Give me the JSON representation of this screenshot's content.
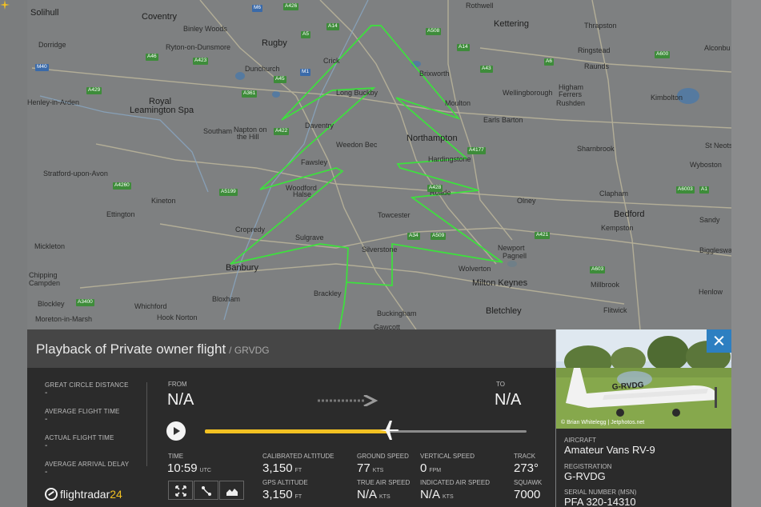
{
  "map": {
    "towns": [
      {
        "name": "Solihull",
        "big": true
      },
      {
        "name": "Coventry",
        "big": true
      },
      {
        "name": "Binley Woods",
        "big": false
      },
      {
        "name": "Ryton-on-Dunsmore",
        "big": false
      },
      {
        "name": "Rugby",
        "big": true
      },
      {
        "name": "Dunchurch",
        "big": false
      },
      {
        "name": "Dorridge",
        "big": false
      },
      {
        "name": "Royal",
        "big": true
      },
      {
        "name": "Leamington Spa",
        "big": true
      },
      {
        "name": "Southam",
        "big": false
      },
      {
        "name": "Napton on",
        "big": false
      },
      {
        "name": "the Hill",
        "big": false
      },
      {
        "name": "Stratford-upon-Avon",
        "big": false
      },
      {
        "name": "Kineton",
        "big": false
      },
      {
        "name": "Ettington",
        "big": false
      },
      {
        "name": "Mickleton",
        "big": false
      },
      {
        "name": "Chipping",
        "big": false
      },
      {
        "name": "Campden",
        "big": false
      },
      {
        "name": "Blockley",
        "big": false
      },
      {
        "name": "Moreton-in-Marsh",
        "big": false
      },
      {
        "name": "Whichford",
        "big": false
      },
      {
        "name": "Hook Norton",
        "big": false
      },
      {
        "name": "Bloxham",
        "big": false
      },
      {
        "name": "Banbury",
        "big": true
      },
      {
        "name": "Cropredy",
        "big": false
      },
      {
        "name": "Sulgrave",
        "big": false
      },
      {
        "name": "Brackley",
        "big": false
      },
      {
        "name": "Crick",
        "big": false
      },
      {
        "name": "Long Buckby",
        "big": false
      },
      {
        "name": "Daventry",
        "big": false
      },
      {
        "name": "Weedon Bec",
        "big": false
      },
      {
        "name": "Fawsley",
        "big": false
      },
      {
        "name": "Woodford",
        "big": false
      },
      {
        "name": "Halse",
        "big": false
      },
      {
        "name": "Towcester",
        "big": false
      },
      {
        "name": "Silverstone",
        "big": false
      },
      {
        "name": "Buckingham",
        "big": false
      },
      {
        "name": "Gawcott",
        "big": false
      },
      {
        "name": "Northampton",
        "big": true
      },
      {
        "name": "Hardingstone",
        "big": false
      },
      {
        "name": "Roade",
        "big": false
      },
      {
        "name": "Brixworth",
        "big": false
      },
      {
        "name": "Moulton",
        "big": false
      },
      {
        "name": "Kettering",
        "big": true
      },
      {
        "name": "Rothwell",
        "big": false
      },
      {
        "name": "Wellingborough",
        "big": false
      },
      {
        "name": "Earls Barton",
        "big": false
      },
      {
        "name": "Higham",
        "big": false
      },
      {
        "name": "Ferrers",
        "big": false
      },
      {
        "name": "Rushden",
        "big": false
      },
      {
        "name": "Thrapston",
        "big": false
      },
      {
        "name": "Ringstead",
        "big": false
      },
      {
        "name": "Raunds",
        "big": false
      },
      {
        "name": "Kimbolton",
        "big": false
      },
      {
        "name": "Alconbu",
        "big": false
      },
      {
        "name": "Sharnbrook",
        "big": false
      },
      {
        "name": "St Neots",
        "big": false
      },
      {
        "name": "Wyboston",
        "big": false
      },
      {
        "name": "Clapham",
        "big": false
      },
      {
        "name": "Bedford",
        "big": true
      },
      {
        "name": "Kempston",
        "big": false
      },
      {
        "name": "Sandy",
        "big": false
      },
      {
        "name": "Biggleswa",
        "big": false
      },
      {
        "name": "Olney",
        "big": false
      },
      {
        "name": "Newport",
        "big": false
      },
      {
        "name": "Pagnell",
        "big": false
      },
      {
        "name": "Wolverton",
        "big": false
      },
      {
        "name": "Milton Keynes",
        "big": true
      },
      {
        "name": "Bletchley",
        "big": true
      },
      {
        "name": "Millbrook",
        "big": false
      },
      {
        "name": "Flitwick",
        "big": false
      },
      {
        "name": "Henlow",
        "big": false
      },
      {
        "name": "Henley-in-Arden",
        "big": false
      }
    ],
    "roads": [
      "M6",
      "A426",
      "A5",
      "A14",
      "A508",
      "A43",
      "A6",
      "A45",
      "M1",
      "A423",
      "A361",
      "A46",
      "A422",
      "A429",
      "A4177",
      "A428",
      "A5199",
      "A34",
      "A509",
      "A421",
      "A603",
      "A600",
      "A1",
      "M40",
      "A3400",
      "A4260",
      "A6003",
      "A14"
    ],
    "track_color": "#3ce23c"
  },
  "panel": {
    "title": "Playback of Private owner flight",
    "callsign": "/ GRVDG",
    "stats": [
      {
        "label": "GREAT CIRCLE DISTANCE",
        "value": "-"
      },
      {
        "label": "AVERAGE FLIGHT TIME",
        "value": "-"
      },
      {
        "label": "ACTUAL FLIGHT TIME",
        "value": "-"
      },
      {
        "label": "AVERAGE ARRIVAL DELAY",
        "value": "-"
      }
    ],
    "from_label": "FROM",
    "from_value": "N/A",
    "to_label": "TO",
    "to_value": "N/A",
    "progress": 0.57,
    "time": {
      "label": "TIME",
      "value": "10:59",
      "unit": "UTC"
    },
    "calibrated_altitude": {
      "label": "CALIBRATED ALTITUDE",
      "value": "3,150",
      "unit": "FT"
    },
    "gps_altitude": {
      "label": "GPS ALTITUDE",
      "value": "3,150",
      "unit": "FT"
    },
    "ground_speed": {
      "label": "GROUND SPEED",
      "value": "77",
      "unit": "KTS"
    },
    "true_air_speed": {
      "label": "TRUE AIR SPEED",
      "value": "N/A",
      "unit": "KTS"
    },
    "vertical_speed": {
      "label": "VERTICAL SPEED",
      "value": "0",
      "unit": "FPM"
    },
    "indicated_air_speed": {
      "label": "INDICATED AIR SPEED",
      "value": "N/A",
      "unit": "KTS"
    },
    "track": {
      "label": "TRACK",
      "value": "273°"
    },
    "squawk": {
      "label": "SQUAWK",
      "value": "7000"
    },
    "logo": {
      "text": "flightradar",
      "number": "24"
    },
    "accent_color": "#f2c122"
  },
  "side": {
    "photo_credit": "© Brian Whitelegg | Jetphotos.net",
    "plane_reg_on_photo": "G-RVDG",
    "aircraft_label": "AIRCRAFT",
    "aircraft_value": "Amateur Vans RV-9",
    "registration_label": "REGISTRATION",
    "registration_value": "G-RVDG",
    "serial_label": "SERIAL NUMBER (MSN)",
    "serial_value": "PFA 320-14310",
    "close_color": "#2d7fc1"
  }
}
